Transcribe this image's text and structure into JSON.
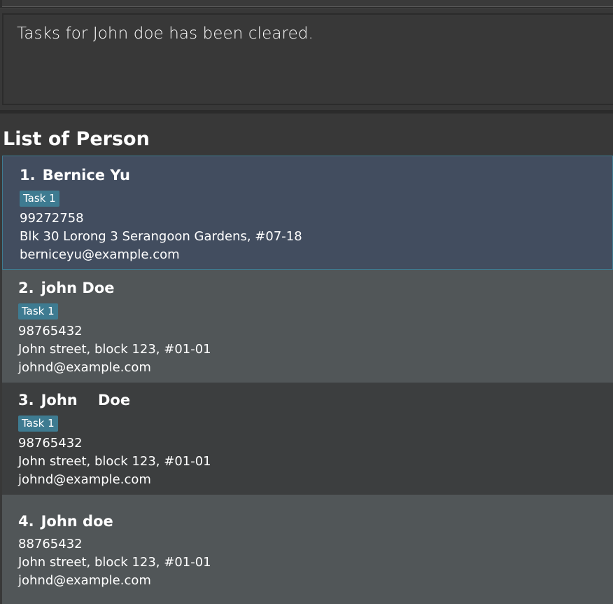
{
  "result": {
    "message": "Tasks for John doe has been cleared."
  },
  "panel": {
    "title": "List of Person"
  },
  "persons": [
    {
      "index": "1.",
      "name": "Bernice Yu",
      "tag": "Task 1",
      "phone": "99272758",
      "address": "Blk 30 Lorong 3 Serangoon Gardens, #07-18",
      "email": "berniceyu@example.com"
    },
    {
      "index": "2.",
      "name": "john Doe",
      "tag": "Task 1",
      "phone": "98765432",
      "address": "John street, block 123, #01-01",
      "email": "johnd@example.com"
    },
    {
      "index": "3.",
      "name": "John    Doe",
      "tag": "Task 1",
      "phone": "98765432",
      "address": "John street, block 123, #01-01",
      "email": "johnd@example.com"
    },
    {
      "index": "4.",
      "name": "John doe",
      "phone": "88765432",
      "address": "John street, block 123, #01-01",
      "email": "johnd@example.com"
    }
  ],
  "colors": {
    "background": "#383838",
    "selected_card": "#424d5f",
    "light_card": "#515658",
    "dark_card": "#3c3e3f",
    "tag": "#3e7b91"
  }
}
